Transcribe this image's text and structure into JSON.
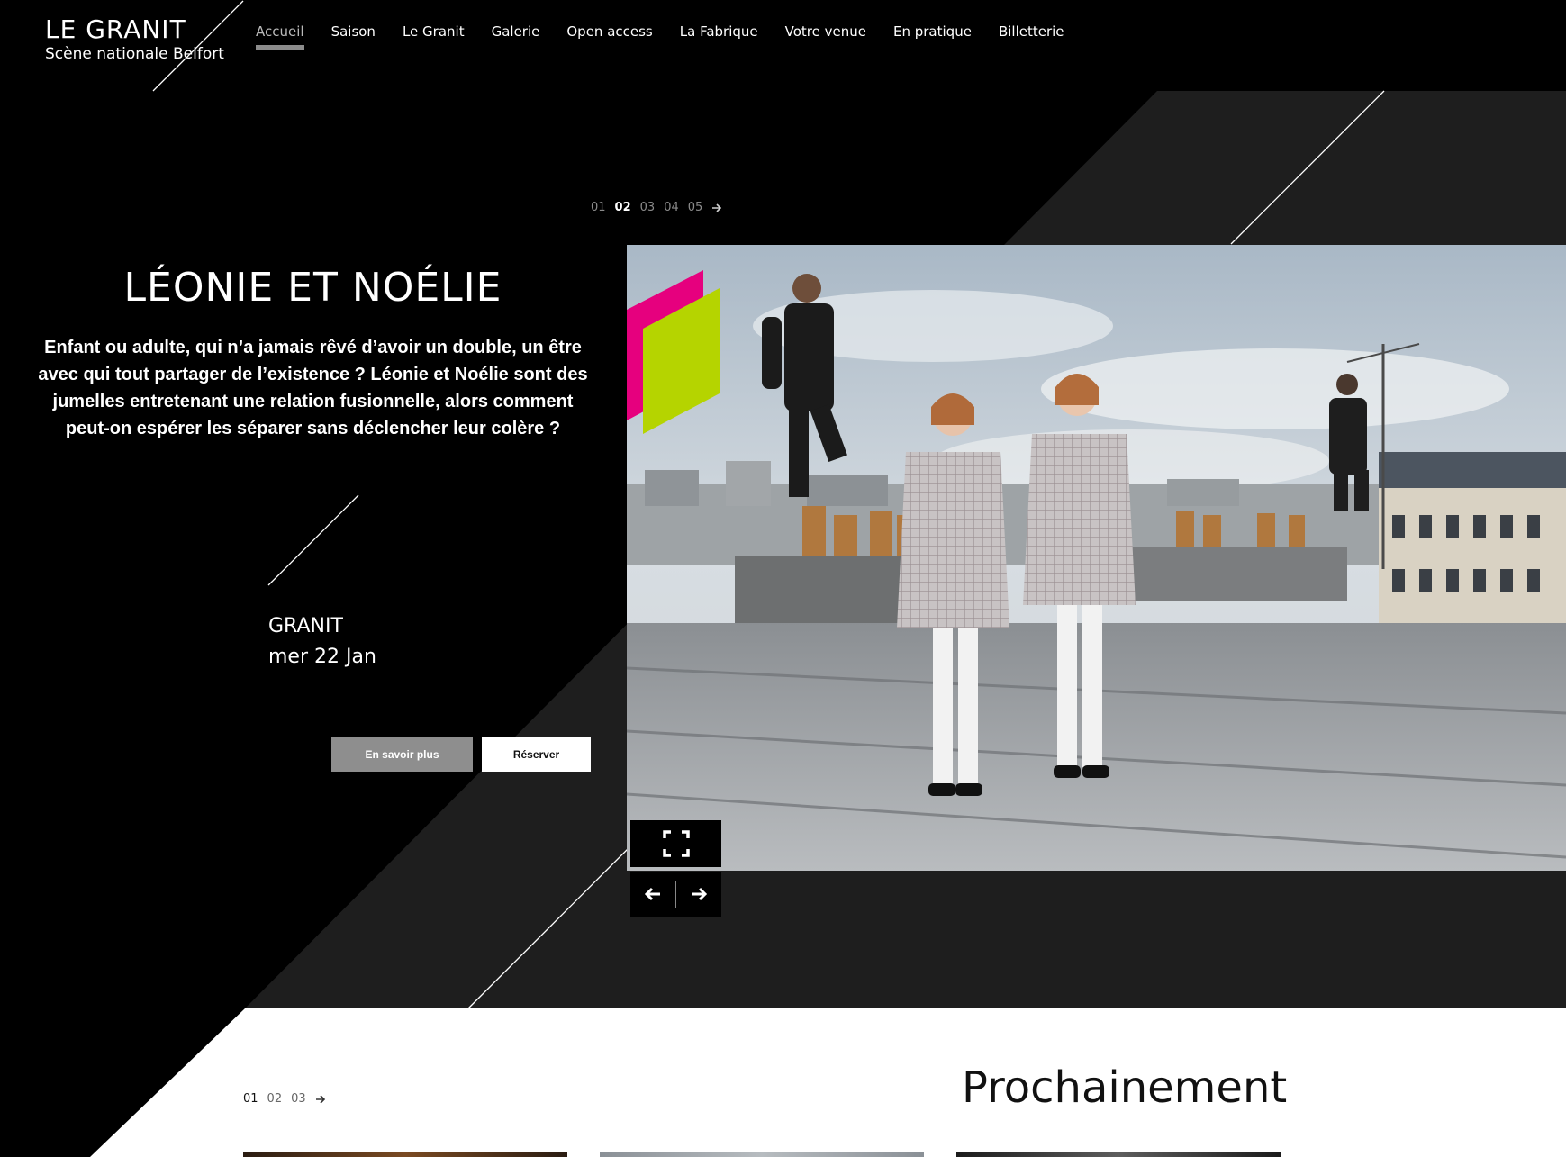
{
  "site": {
    "title": "LE GRANIT",
    "subtitle": "Scène nationale Belfort"
  },
  "nav": {
    "items": [
      {
        "label": "Accueil"
      },
      {
        "label": "Saison"
      },
      {
        "label": "Le Granit"
      },
      {
        "label": "Galerie"
      },
      {
        "label": "Open access"
      },
      {
        "label": "La Fabrique"
      },
      {
        "label": "Votre venue"
      },
      {
        "label": "En pratique"
      },
      {
        "label": "Billetterie"
      }
    ],
    "active": "Accueil"
  },
  "hero": {
    "pager": [
      "01",
      "02",
      "03",
      "04",
      "05"
    ],
    "current": "02",
    "title": "LÉONIE ET NOÉLIE",
    "description": "Enfant ou adulte, qui n’a jamais rêvé d’avoir un double, un être avec qui tout partager de l’existence ? Léonie et Noélie sont des jumelles entretenant une relation fusionnelle, alors comment peut-on espérer les séparer sans déclencher leur colère ?",
    "venue": "GRANIT",
    "date": "mer 22 Jan",
    "more_label": "En savoir plus",
    "book_label": "Réserver",
    "photo_icon": "fullscreen-icon"
  },
  "upcoming": {
    "title": "Prochainement",
    "pager": [
      "01",
      "02",
      "03"
    ],
    "current": "01"
  },
  "colors": {
    "background": "#000000",
    "panel": "#1e1e1e",
    "accent_magenta": "#e6007e",
    "accent_lime": "#b5d400",
    "nav_active": "#8c8c8c"
  }
}
